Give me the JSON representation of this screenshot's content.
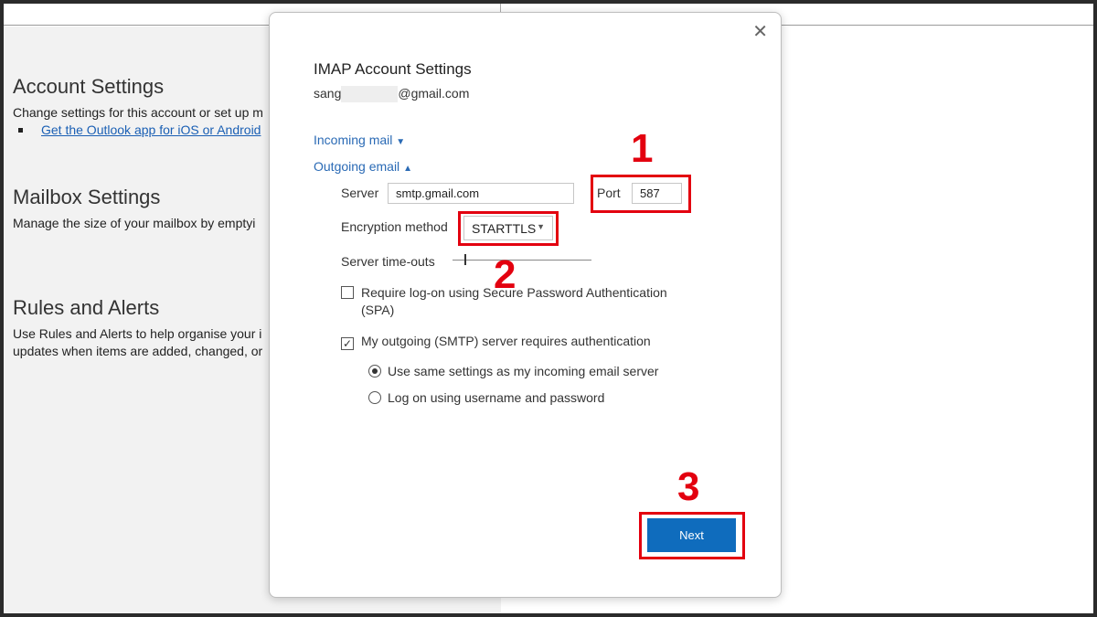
{
  "background": {
    "account": {
      "title": "Account Settings",
      "desc": "Change settings for this account or set up m",
      "link": "Get the Outlook app for iOS or Android"
    },
    "mailbox": {
      "title": "Mailbox Settings",
      "desc": "Manage the size of your mailbox by emptyi"
    },
    "rules": {
      "title": "Rules and Alerts",
      "desc1": "Use Rules and Alerts to help organise your i",
      "desc2": "updates when items are added, changed, or"
    }
  },
  "dialog": {
    "close": "✕",
    "title": "IMAP Account Settings",
    "email_prefix": "sang",
    "email_suffix": "@gmail.com",
    "incoming": "Incoming mail",
    "outgoing": "Outgoing email",
    "server_label": "Server",
    "server_value": "smtp.gmail.com",
    "port_label": "Port",
    "port_value": "587",
    "encryption_label": "Encryption method",
    "encryption_value": "STARTTLS",
    "timeouts_label": "Server time-outs",
    "spa_label": "Require log-on using Secure Password Authentication",
    "spa_label2": "(SPA)",
    "spa_checked": false,
    "smtp_auth_label": "My outgoing (SMTP) server requires authentication",
    "smtp_auth_checked": true,
    "radio_same": "Use same settings as my incoming email server",
    "radio_logon": "Log on using username and password",
    "next": "Next"
  },
  "annotations": [
    "1",
    "2",
    "3"
  ]
}
